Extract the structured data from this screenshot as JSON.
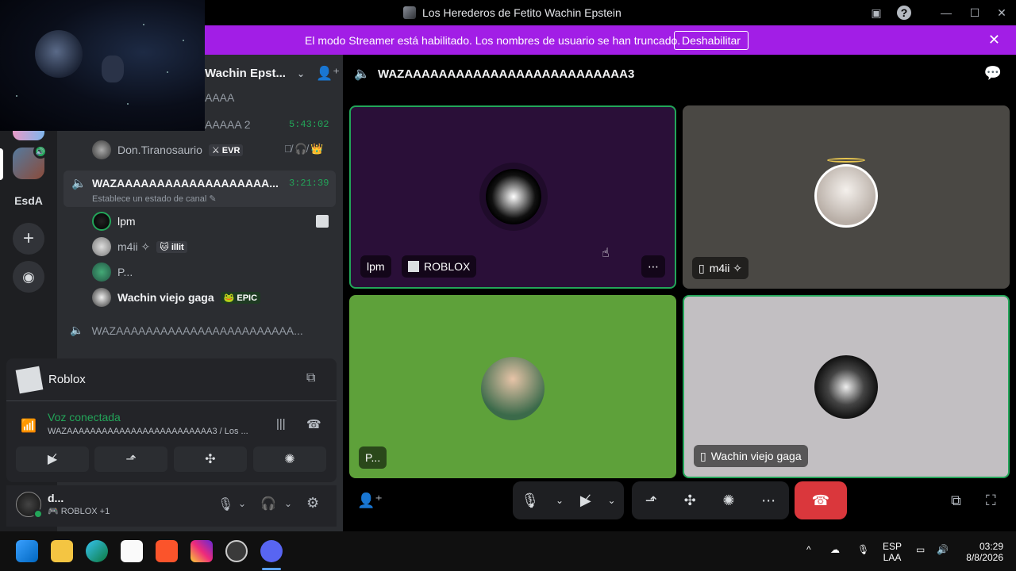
{
  "window": {
    "title": "Los Herederos de Fetito Wachin Epstein",
    "minimize": "—",
    "maximize": "☐",
    "close": "✕"
  },
  "banner": {
    "message": "El modo Streamer está habilitado. Los nombres de usuario se han truncado.",
    "disable_label": "Deshabilitar",
    "close": "✕"
  },
  "server": {
    "name_truncated": "Wachin Epst...",
    "folder_label": "EsdA"
  },
  "channels": {
    "row1": "AAAA",
    "row2": "AAAAA 2",
    "row2_time": "5:43:02",
    "member_don": "Don.Tiranosaurio",
    "member_don_tag": "⚔ EVR",
    "active_name": "WAZAAAAAAAAAAAAAAAAAAA...",
    "active_time": "3:21:39",
    "active_status": "Establece un estado de canal",
    "members": [
      {
        "name": "lpm",
        "tag": ""
      },
      {
        "name": "m4ii ✧",
        "tag": "🐱 illit"
      },
      {
        "name": "P...",
        "tag": ""
      },
      {
        "name": "Wachin viejo gaga",
        "tag": "🐸 EPIC"
      }
    ],
    "next_channel": "WAZAAAAAAAAAAAAAAAAAAAAAAAA..."
  },
  "voice_panel": {
    "activity": "Roblox",
    "status": "Voz conectada",
    "channel_path": "WAZAAAAAAAAAAAAAAAAAAAAAAAAA3 / Los ..."
  },
  "user": {
    "name": "d...",
    "activity": "ROBLOX +1"
  },
  "main": {
    "channel_title": "WAZAAAAAAAAAAAAAAAAAAAAAAAAAA3",
    "tiles": [
      {
        "name": "lpm",
        "activity": "ROBLOX",
        "bg": "#2a0f38"
      },
      {
        "name": "m4ii ✧",
        "bg": "#4a4844"
      },
      {
        "name": "P...",
        "bg": "#5ea13a"
      },
      {
        "name": "Wachin viejo gaga",
        "bg": "#c2bfc2"
      }
    ],
    "more": "⋯"
  },
  "taskbar": {
    "lang_top": "ESP",
    "lang_bottom": "LAA",
    "time": "03:29",
    "date": "8/8/2026"
  },
  "colors": {
    "accent": "#a21ee6",
    "speaking": "#23a559",
    "hangup": "#da373c"
  }
}
